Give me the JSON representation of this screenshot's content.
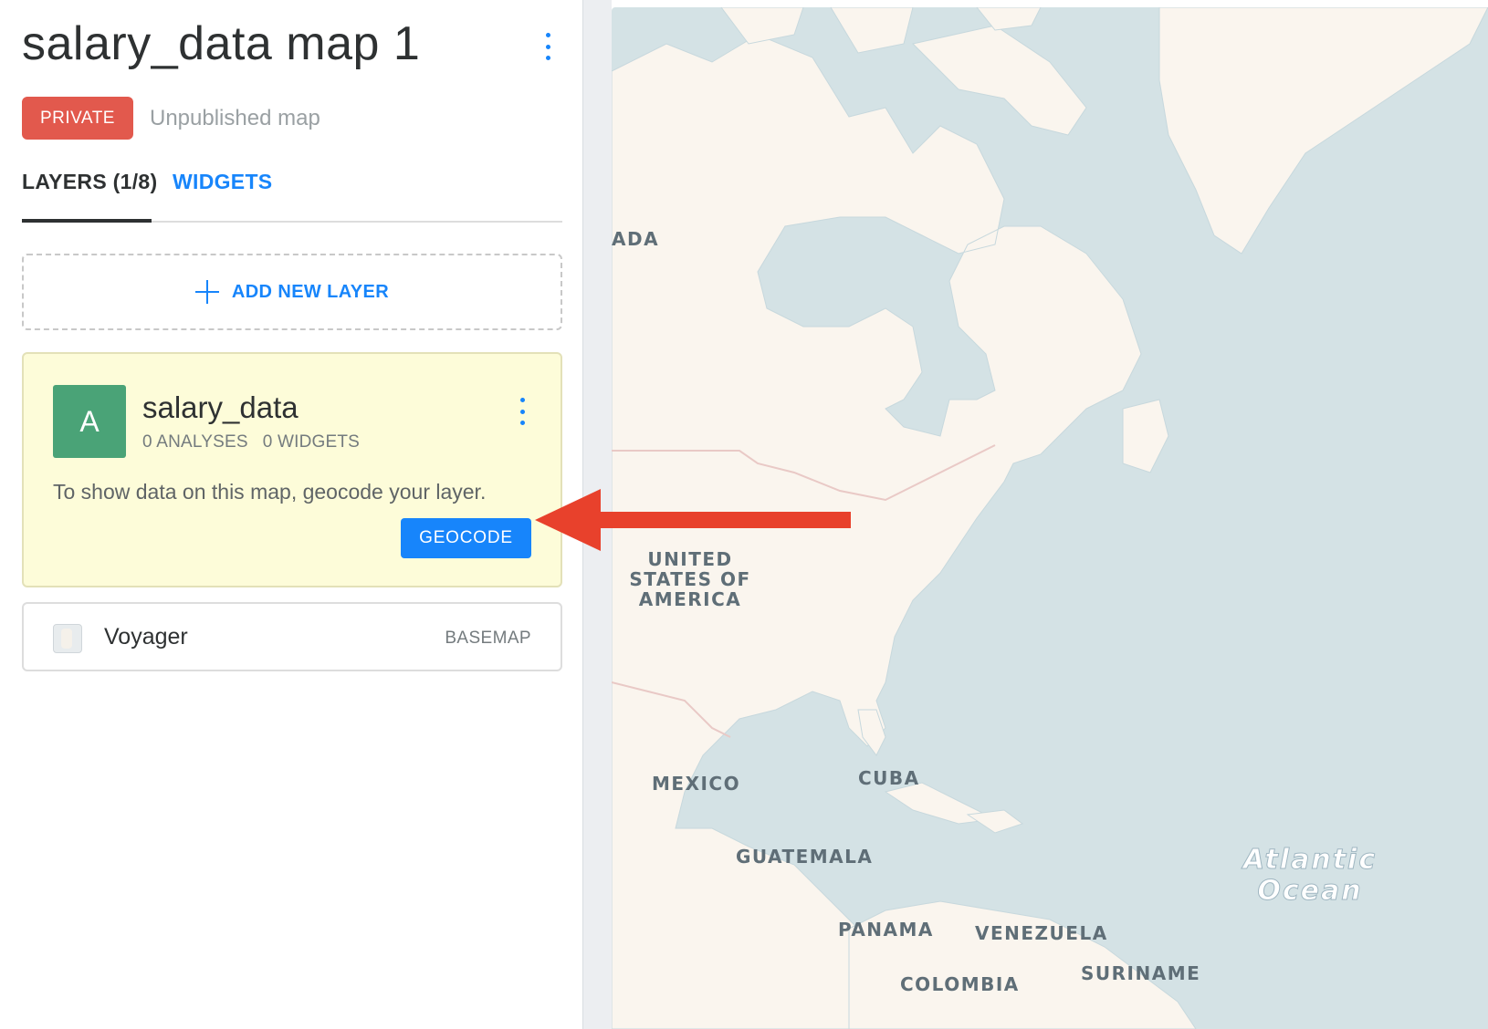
{
  "header": {
    "title": "salary_data map 1",
    "privacy_badge": "PRIVATE",
    "publish_status": "Unpublished map",
    "menu_icon": "kebab-vertical-icon"
  },
  "tabs": [
    {
      "label": "LAYERS (1/8)",
      "active": true
    },
    {
      "label": "WIDGETS",
      "active": false
    }
  ],
  "add_layer": {
    "label": "ADD NEW LAYER",
    "icon": "plus-icon"
  },
  "layers": [
    {
      "letter": "A",
      "name": "salary_data",
      "analyses": "0 ANALYSES",
      "widgets": "0 WIDGETS",
      "message": "To show data on this map, geocode your layer.",
      "action_label": "GEOCODE",
      "color": "#4aa377"
    }
  ],
  "basemap": {
    "name": "Voyager",
    "type": "BASEMAP"
  },
  "map": {
    "labels": [
      {
        "text": "ADA"
      },
      {
        "text": "UNITED STATES OF AMERICA"
      },
      {
        "text": "MEXICO"
      },
      {
        "text": "CUBA"
      },
      {
        "text": "GUATEMALA"
      },
      {
        "text": "PANAMA"
      },
      {
        "text": "VENEZUELA"
      },
      {
        "text": "SURINAME"
      },
      {
        "text": "COLOMBIA"
      },
      {
        "text": "Atlantic Ocean"
      }
    ],
    "colors": {
      "water": "#d4e2e5",
      "land": "#faf5ee",
      "border": "#e9c9c6"
    }
  },
  "annotation": {
    "color": "#e8412c",
    "icon": "red-arrow-left-icon"
  },
  "colors": {
    "accent": "#1785fb",
    "private_badge": "#e2594d",
    "layer_card_bg": "#fdfcd9"
  }
}
